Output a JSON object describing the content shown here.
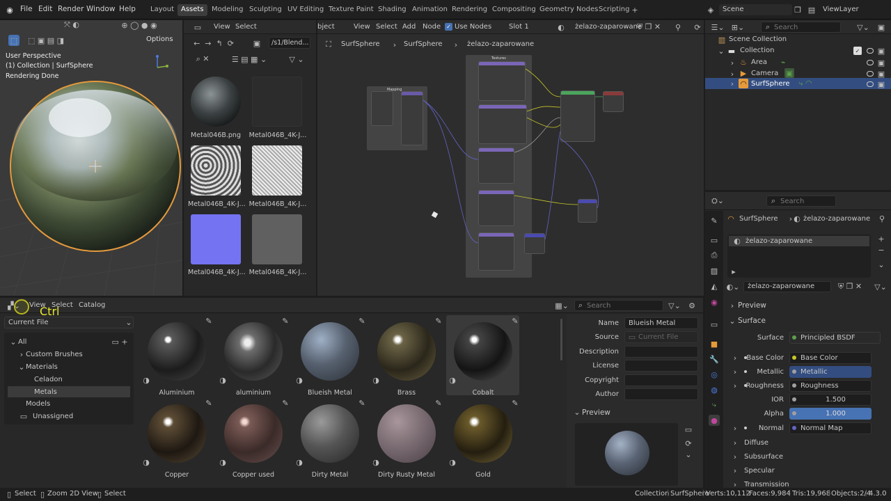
{
  "topbar": {
    "menus": [
      "File",
      "Edit",
      "Render",
      "Window",
      "Help"
    ],
    "tabs": [
      "Layout",
      "Assets",
      "Modeling",
      "Sculpting",
      "UV Editing",
      "Texture Paint",
      "Shading",
      "Animation",
      "Rendering",
      "Compositing",
      "Geometry Nodes",
      "Scripting"
    ],
    "active_tab": "Assets",
    "scene": "Scene",
    "view_layer": "ViewLayer"
  },
  "viewport": {
    "perspective": "User Perspective",
    "collection": "(1) Collection | SurfSphere",
    "status": "Rendering Done",
    "options": "Options"
  },
  "file_browser": {
    "menu_view": "View",
    "menu_select": "Select",
    "path": "/s1/Blend...",
    "files": [
      "Metal046B.png",
      "Metal046B_4K-J...",
      "Metal046B_4K-J...",
      "Metal046B_4K-J...",
      "Metal046B_4K-J...",
      "Metal046B_4K-J..."
    ]
  },
  "node_editor": {
    "menu_object": "bject",
    "menu_view": "View",
    "menu_select": "Select",
    "menu_add": "Add",
    "menu_node": "Node",
    "use_nodes": "Use Nodes",
    "slot": "Slot 1",
    "material": "żelazo-zaparowane",
    "crumb1": "SurfSphere",
    "crumb2": "SurfSphere",
    "crumb3": "żelazo-zaparowane",
    "frame_textures": "Textures",
    "frame_mapping": "Mapping"
  },
  "outliner": {
    "search": "Search",
    "scene_collection": "Scene Collection",
    "collection": "Collection",
    "items": [
      "Area",
      "Camera",
      "SurfSphere"
    ]
  },
  "properties": {
    "search": "Search",
    "crumb_object": "SurfSphere",
    "crumb_material": "żelazo-zaparowane",
    "slot_name": "żelazo-zaparowane",
    "material_name": "żelazo-zaparowane",
    "preview": "Preview",
    "surface": "Surface",
    "surface_label": "Surface",
    "surface_value": "Principled BSDF",
    "rows": [
      {
        "label": "Base Color",
        "value": "Base Color"
      },
      {
        "label": "Metallic",
        "value": "Metallic"
      },
      {
        "label": "Roughness",
        "value": "Roughness"
      },
      {
        "label": "IOR",
        "value": "1.500"
      },
      {
        "label": "Alpha",
        "value": "1.000"
      },
      {
        "label": "Normal",
        "value": "Normal Map"
      }
    ],
    "sections": [
      "Diffuse",
      "Subsurface",
      "Specular",
      "Transmission"
    ]
  },
  "asset_browser": {
    "menu_view": "View",
    "menu_select": "Select",
    "menu_catalog": "Catalog",
    "key_hint": "Ctrl",
    "library": "Current File",
    "search": "Search",
    "tree": {
      "all": "All",
      "custom_brushes": "Custom Brushes",
      "materials": "Materials",
      "celadon": "Celadon",
      "metals": "Metals",
      "models": "Models",
      "unassigned": "Unassigned"
    },
    "assets": [
      "Aluminium",
      "aluminium",
      "Blueish Metal",
      "Brass",
      "Cobalt",
      "Copper",
      "Copper used",
      "Dirty Metal",
      "Dirty Rusty Metal",
      "Gold"
    ]
  },
  "asset_meta": {
    "name_label": "Name",
    "name": "Blueish Metal",
    "source_label": "Source",
    "source": "Current File",
    "description_label": "Description",
    "license_label": "License",
    "copyright_label": "Copyright",
    "author_label": "Author",
    "preview": "Preview"
  },
  "statusbar": {
    "select1": "Select",
    "zoom": "Zoom 2D View",
    "select2": "Select",
    "collection": "Collection",
    "object": "SurfSphere",
    "verts": "Verts:10,112",
    "faces": "Faces:9,984",
    "tris": "Tris:19,968",
    "objects": "Objects:2/4",
    "version": "4.3.0"
  },
  "colors": {
    "accent": "#4772b3",
    "header": "#2b2b2b",
    "panel": "#282828",
    "selected": "#334d80",
    "orange": "#e79a3a",
    "green_tab": "#5da04b"
  }
}
